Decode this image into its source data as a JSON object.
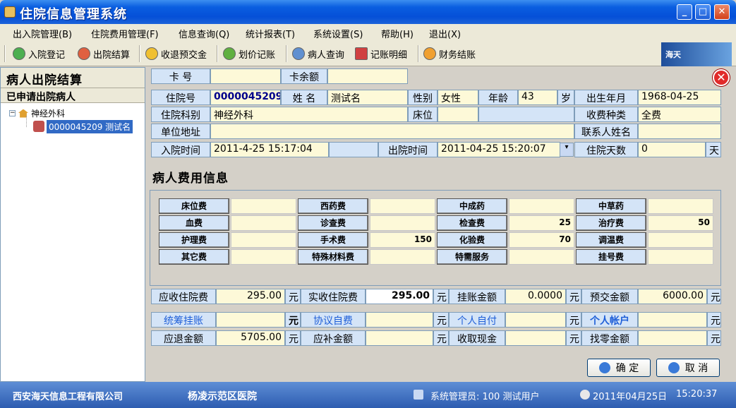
{
  "window": {
    "title": "住院信息管理系统"
  },
  "menu": [
    "出入院管理(B)",
    "住院费用管理(F)",
    "信息查询(Q)",
    "统计报表(T)",
    "系统设置(S)",
    "帮助(H)",
    "退出(X)"
  ],
  "toolbar": [
    "入院登记",
    "出院结算",
    "收退预交金",
    "划价记账",
    "病人查询",
    "记账明细",
    "财务结账"
  ],
  "logo_text": "海天",
  "left": {
    "title": "病人出院结算",
    "subtitle": "已申请出院病人",
    "dept": "神经外科",
    "patient": "0000045209  测试名"
  },
  "card": {
    "card_no_label": "卡   号",
    "card_no": "",
    "balance_label": "卡余额",
    "balance": ""
  },
  "patient": {
    "admission_no_label": "住院号",
    "admission_no": "0000045209",
    "name_label": "姓  名",
    "name": "测试名",
    "gender_label": "性别",
    "gender": "女性",
    "age_label": "年龄",
    "age": "43",
    "age_unit": "岁",
    "birth_label": "出生年月",
    "birth": "1968-04-25",
    "dept_label": "住院科别",
    "dept": "神经外科",
    "bed_label": "床位",
    "bed": "",
    "fee_type_label": "收费种类",
    "fee_type": "全费",
    "address_label": "单位地址",
    "address": "",
    "contact_label": "联系人姓名",
    "contact": "",
    "admit_time_label": "入院时间",
    "admit_time": "2011-4-25 15:17:04",
    "discharge_time_label": "出院时间",
    "discharge_time": "2011-04-25 15:20:07",
    "days_label": "住院天数",
    "days": "0",
    "days_unit": "天"
  },
  "fees_title": "病人费用信息",
  "fees": [
    [
      {
        "label": "床位费",
        "value": ""
      },
      {
        "label": "西药费",
        "value": ""
      },
      {
        "label": "中成药",
        "value": ""
      },
      {
        "label": "中草药",
        "value": ""
      }
    ],
    [
      {
        "label": "血费",
        "value": ""
      },
      {
        "label": "诊查费",
        "value": ""
      },
      {
        "label": "检查费",
        "value": "25"
      },
      {
        "label": "治疗费",
        "value": "50"
      }
    ],
    [
      {
        "label": "护理费",
        "value": ""
      },
      {
        "label": "手术费",
        "value": "150"
      },
      {
        "label": "化验费",
        "value": "70"
      },
      {
        "label": "调温费",
        "value": ""
      }
    ],
    [
      {
        "label": "其它费",
        "value": ""
      },
      {
        "label": "特殊材料费",
        "value": ""
      },
      {
        "label": "特需服务",
        "value": ""
      },
      {
        "label": "挂号费",
        "value": ""
      }
    ]
  ],
  "totals": {
    "receivable_label": "应收住院费",
    "receivable": "295.00",
    "received_label": "实收住院费",
    "received": "295.00",
    "credit_label": "挂账金额",
    "credit": "0.0000",
    "prepaid_label": "预交金额",
    "prepaid": "6000.00",
    "pooled_label": "统筹挂账",
    "pooled": "",
    "agreement_label": "协议自费",
    "agreement": "",
    "self_pay_label": "个人自付",
    "self_pay": "",
    "account_label": "个人帐户",
    "account": "",
    "refund_label": "应退金额",
    "refund": "5705.00",
    "supplement_label": "应补金额",
    "supplement": "",
    "cash_label": "收取现金",
    "cash": "",
    "change_label": "找零金额",
    "change": "",
    "unit": "元"
  },
  "buttons": {
    "ok": "确 定",
    "cancel": "取 消"
  },
  "status": {
    "company": "西安海天信息工程有限公司",
    "hospital": "杨凌示范区医院",
    "user": "系统管理员: 100  测试用户",
    "date": "2011年04月25日",
    "time": "15:20:37"
  }
}
